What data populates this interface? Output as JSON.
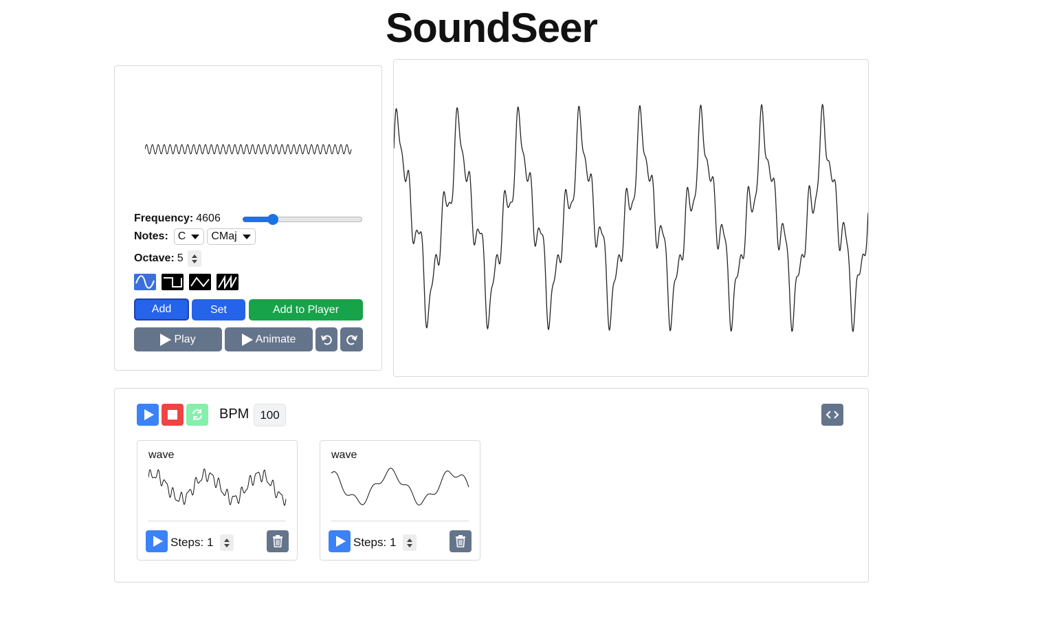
{
  "app": {
    "title": "SoundSeer"
  },
  "controls": {
    "frequency_label": "Frequency:",
    "frequency_value": "4606",
    "frequency_slider_fraction": 0.25,
    "notes_label": "Notes:",
    "note_selected": "C",
    "scale_selected": "CMaj",
    "octave_label": "Octave:",
    "octave_value": "5",
    "waveforms": [
      "sine-wave-icon",
      "square-wave-icon",
      "triangle-wave-icon",
      "sawtooth-wave-icon"
    ],
    "active_waveform": "sine",
    "add_label": "Add",
    "set_label": "Set",
    "add_to_player_label": "Add to Player",
    "play_label": "Play",
    "animate_label": "Animate"
  },
  "player": {
    "bpm_label": "BPM",
    "bpm_value": "100",
    "tracks": [
      {
        "name": "wave",
        "steps_label": "Steps:",
        "steps_value": "1"
      },
      {
        "name": "wave",
        "steps_label": "Steps:",
        "steps_value": "1"
      }
    ]
  },
  "colors": {
    "primary": "#2563eb",
    "success": "#16a34a",
    "danger": "#ef4444",
    "secondary": "#64748b",
    "loop": "#86efac"
  }
}
